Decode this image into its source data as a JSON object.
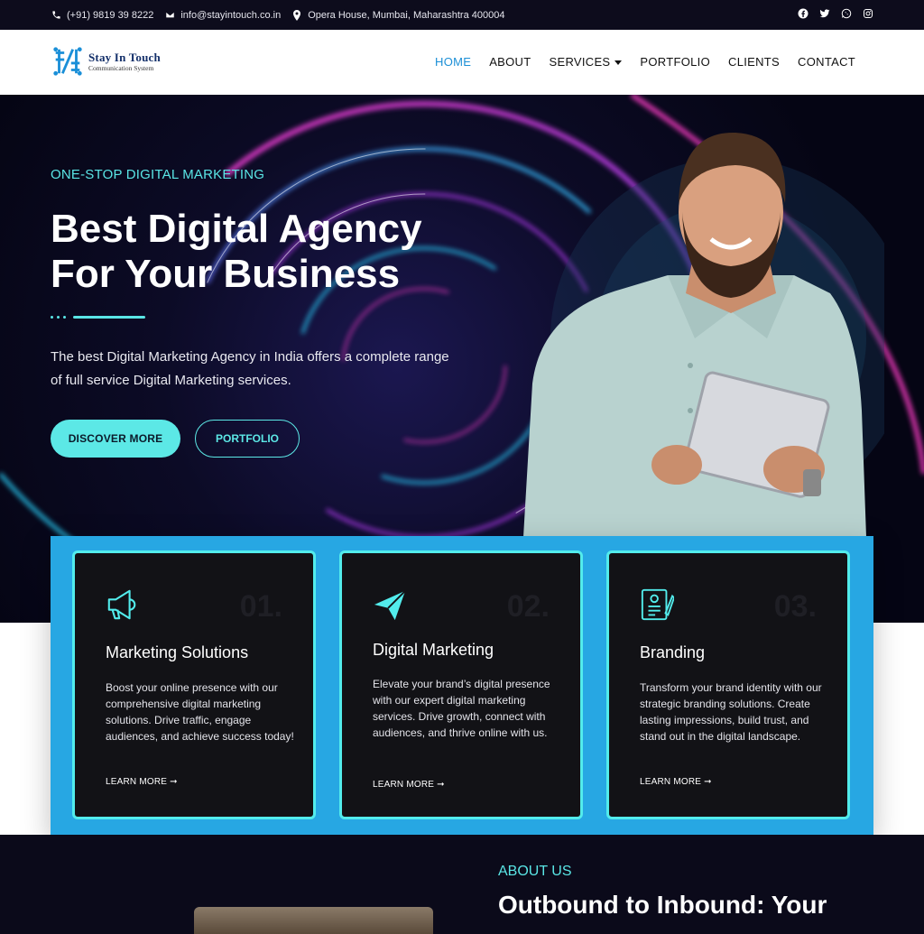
{
  "topbar": {
    "phone": "(+91) 9819 39 8222",
    "email": "info@stayintouch.co.in",
    "address": "Opera House, Mumbai, Maharashtra 400004",
    "social_icons": [
      "facebook-icon",
      "twitter-icon",
      "whatsapp-icon",
      "instagram-icon"
    ]
  },
  "header": {
    "logo_title": "Stay In Touch",
    "logo_subtitle": "Communication System",
    "nav": [
      {
        "label": "HOME",
        "active": true
      },
      {
        "label": "ABOUT"
      },
      {
        "label": "SERVICES"
      },
      {
        "label": "PORTFOLIO"
      },
      {
        "label": "CLIENTS"
      },
      {
        "label": "CONTACT"
      }
    ]
  },
  "hero": {
    "eyebrow": "ONE-STOP DIGITAL MARKETING",
    "title_line1": "Best Digital Agency",
    "title_line2": "For Your Business",
    "description": "The best Digital Marketing Agency in India offers a complete range of full service Digital Marketing services.",
    "primary_button": "DISCOVER MORE",
    "secondary_button": "PORTFOLIO"
  },
  "services": [
    {
      "number": "01.",
      "icon": "megaphone-icon",
      "title": "Marketing Solutions",
      "text": "Boost your online presence with our comprehensive digital marketing solutions. Drive traffic, engage audiences, and achieve success today!",
      "link": "LEARN MORE ➞"
    },
    {
      "number": "02.",
      "icon": "paper-plane-icon",
      "title": "Digital Marketing",
      "text": "Elevate your brand’s digital presence with our expert digital marketing services. Drive growth, connect with audiences, and thrive online with us.",
      "link": "LEARN MORE ➞"
    },
    {
      "number": "03.",
      "icon": "document-pen-icon",
      "title": "Branding",
      "text": "Transform your brand identity with our strategic branding solutions. Create lasting impressions, build trust, and stand out in the digital landscape.",
      "link": "LEARN MORE ➞"
    }
  ],
  "about": {
    "label": "ABOUT US",
    "heading": "Outbound to Inbound: Your"
  },
  "colors": {
    "accent": "#5ce8e6",
    "panel": "#27a7e3",
    "nav_active": "#1c8fd6"
  }
}
